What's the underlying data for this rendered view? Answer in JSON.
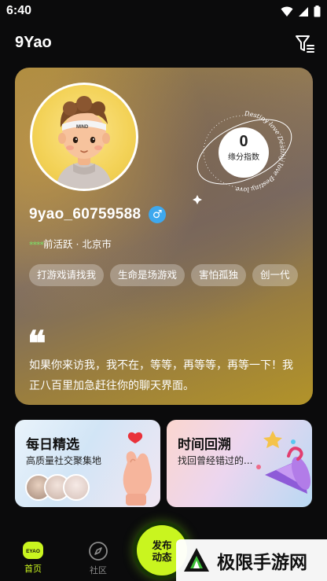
{
  "status_bar": {
    "time": "6:40"
  },
  "header": {
    "app_title": "9Yao"
  },
  "profile": {
    "avatar_cap_text": "MIND",
    "fate_index": {
      "value": "0",
      "label": "缘分指数",
      "ring_text": "Destiny love Destiny love Destiny love"
    },
    "username": "9yao_60759588",
    "gender_symbol": "♂",
    "activity": {
      "stars": "****",
      "text": "前活跃 · 北京市"
    },
    "tags": [
      "打游戏请找我",
      "生命是场游戏",
      "害怕孤独",
      "创一代"
    ],
    "quote_mark": "❝",
    "bio": "如果你来访我，我不在，等等，再等等，再等一下！我正八百里加急赶往你的聊天界面。"
  },
  "features": {
    "daily": {
      "title": "每日精选",
      "subtitle": "高质量社交聚集地"
    },
    "rewind": {
      "title": "时间回溯",
      "subtitle": "找回曾经错过的..."
    }
  },
  "nav": {
    "home": {
      "label": "首页",
      "logo_text": "EYAO"
    },
    "community": {
      "label": "社区"
    },
    "publish": {
      "line1": "发布",
      "line2": "动态"
    }
  },
  "watermark": {
    "text": "极限手游网"
  },
  "colors": {
    "accent": "#c9f51f",
    "gender": "#3ea8ee",
    "stars": "#7be36b"
  }
}
